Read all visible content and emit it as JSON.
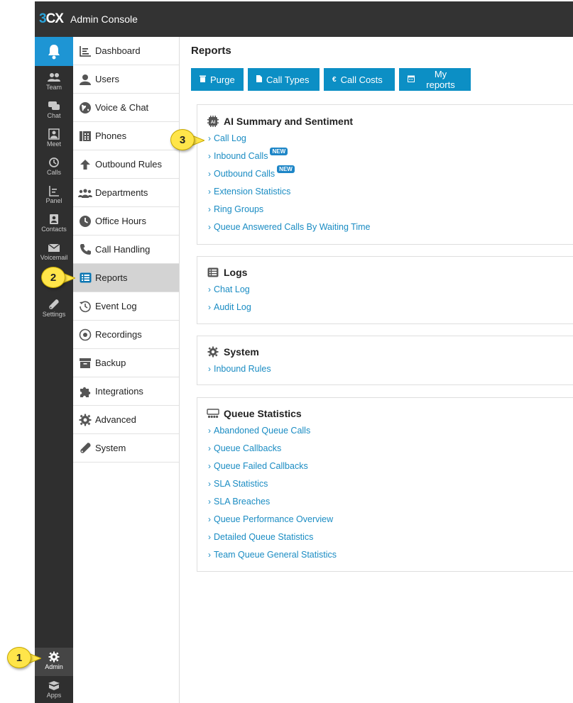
{
  "app": {
    "logo_part1": "3",
    "logo_part2": "CX",
    "title": "Admin Console"
  },
  "rail": {
    "items": [
      {
        "label": "Team",
        "icon": "team-icon"
      },
      {
        "label": "Chat",
        "icon": "chat-icon"
      },
      {
        "label": "Meet",
        "icon": "meet-icon"
      },
      {
        "label": "Calls",
        "icon": "calls-icon"
      },
      {
        "label": "Panel",
        "icon": "panel-icon"
      },
      {
        "label": "Contacts",
        "icon": "contacts-icon"
      },
      {
        "label": "Voicemail",
        "icon": "voicemail-icon"
      },
      {
        "label": "Settings",
        "icon": "settings-icon"
      },
      {
        "label": "Admin",
        "icon": "admin-gear-icon"
      },
      {
        "label": "Apps",
        "icon": "apps-icon"
      }
    ]
  },
  "sidebar": {
    "items": [
      {
        "label": "Dashboard"
      },
      {
        "label": "Users"
      },
      {
        "label": "Voice & Chat"
      },
      {
        "label": "Phones"
      },
      {
        "label": "Outbound Rules"
      },
      {
        "label": "Departments"
      },
      {
        "label": "Office Hours"
      },
      {
        "label": "Call Handling"
      },
      {
        "label": "Reports"
      },
      {
        "label": "Event Log"
      },
      {
        "label": "Recordings"
      },
      {
        "label": "Backup"
      },
      {
        "label": "Integrations"
      },
      {
        "label": "Advanced"
      },
      {
        "label": "System"
      }
    ],
    "active": "Reports"
  },
  "main": {
    "title": "Reports",
    "buttons": [
      {
        "label": "Purge",
        "icon": "trash-icon"
      },
      {
        "label": "Call Types",
        "icon": "document-icon"
      },
      {
        "label": "Call Costs",
        "icon": "euro-icon"
      },
      {
        "label": "My reports",
        "icon": "calendar-icon"
      }
    ],
    "badge_label": "NEW",
    "sections": [
      {
        "title": "AI Summary and Sentiment",
        "links": [
          "Call Log",
          "Inbound Calls",
          "Outbound Calls",
          "Extension Statistics",
          "Ring Groups",
          "Queue Answered Calls By Waiting Time"
        ]
      },
      {
        "title": "Logs",
        "links": [
          "Chat Log",
          "Audit Log"
        ]
      },
      {
        "title": "System",
        "links": [
          "Inbound Rules"
        ]
      },
      {
        "title": "Queue Statistics",
        "links": [
          "Abandoned Queue Calls",
          "Queue Callbacks",
          "Queue Failed Callbacks",
          "SLA Statistics",
          "SLA Breaches",
          "Queue Performance Overview",
          "Detailed Queue Statistics",
          "Team Queue General Statistics"
        ]
      }
    ]
  },
  "callouts": [
    "1",
    "2",
    "3"
  ],
  "colors": {
    "accent": "#0c8fc5",
    "link": "#1a8cc3",
    "callout": "#ffe54a",
    "topbar": "#333333",
    "rail_active": "#1e95d4"
  }
}
